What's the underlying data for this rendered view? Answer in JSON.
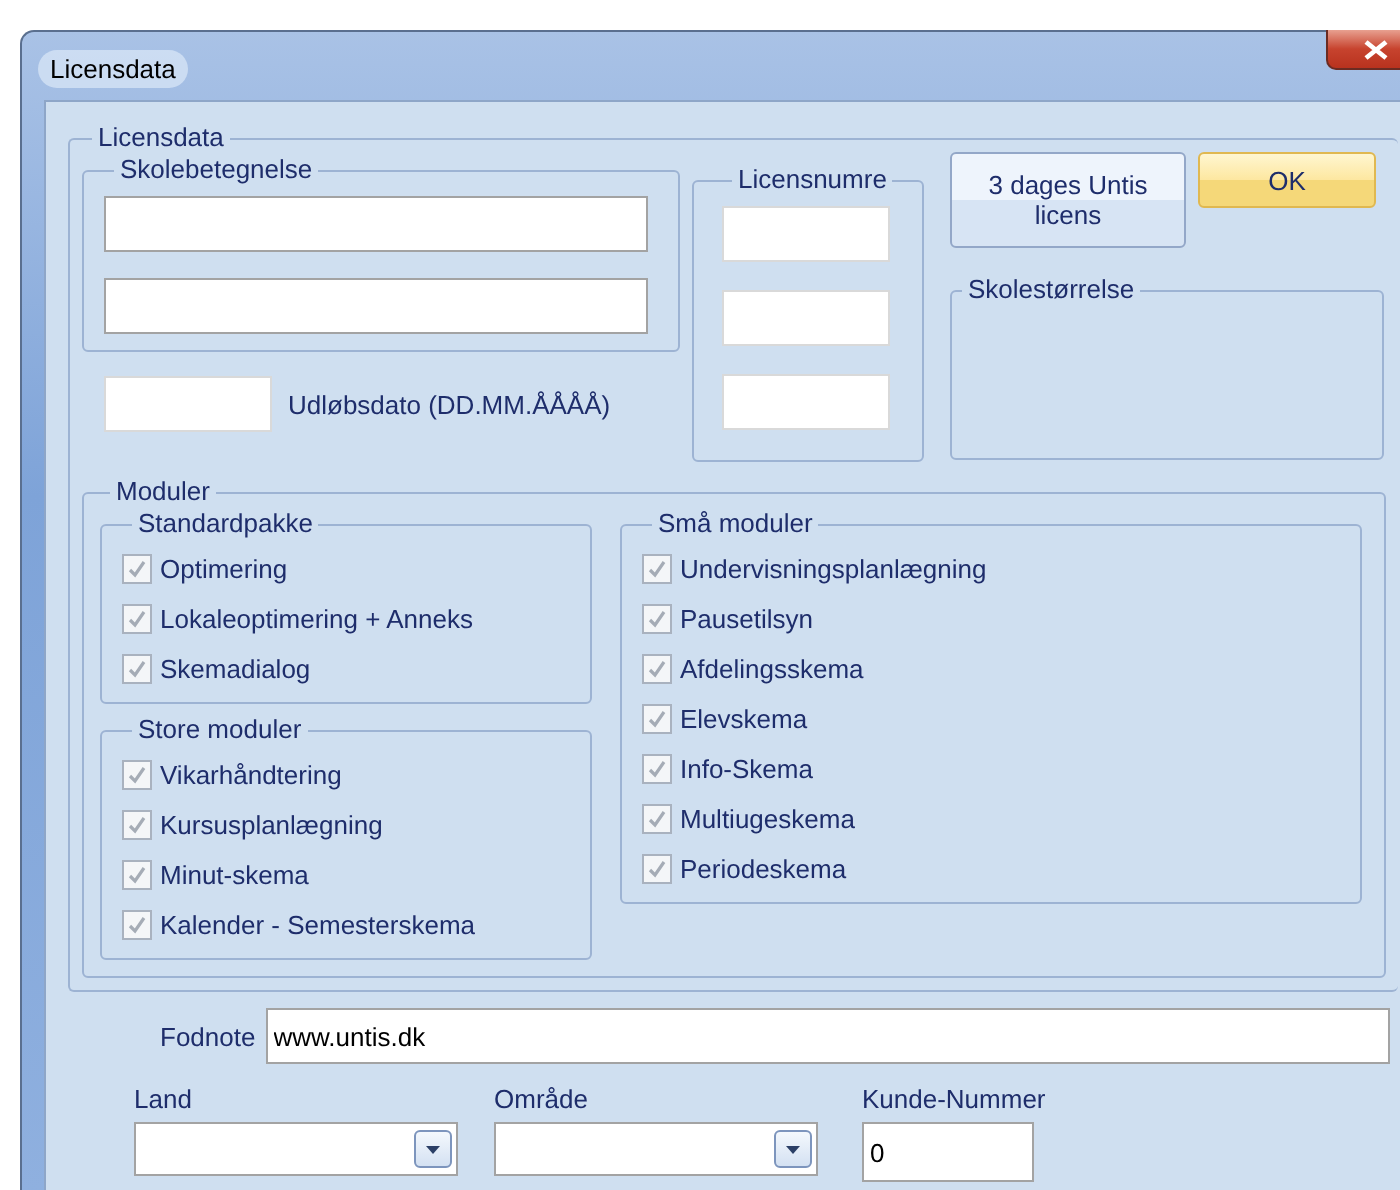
{
  "window": {
    "title": "Licensdata"
  },
  "license": {
    "title": "Licensdata",
    "school_name": {
      "title": "Skolebetegnelse"
    },
    "expiry": {
      "label": "Udløbsdato (DD.MM.ÅÅÅÅ)"
    },
    "license_numbers": {
      "title": "Licensnumre"
    },
    "buttons": [
      {
        "label": "3 dages Untis licens",
        "default": false
      },
      {
        "label": "OK",
        "default": true
      }
    ],
    "school_size": {
      "title": "Skolestørrelse"
    },
    "modules": {
      "title": "Moduler",
      "groups": [
        {
          "title": "Standardpakke",
          "items": [
            {
              "label": "Optimering",
              "checked": true,
              "disabled": true
            },
            {
              "label": "Lokaleoptimering + Anneks",
              "checked": true,
              "disabled": true
            },
            {
              "label": "Skemadialog",
              "checked": true,
              "disabled": true
            }
          ]
        },
        {
          "title": "Store moduler",
          "items": [
            {
              "label": "Vikarhåndtering",
              "checked": true,
              "disabled": true
            },
            {
              "label": "Kursusplanlægning",
              "checked": true,
              "disabled": true
            },
            {
              "label": "Minut-skema",
              "checked": true,
              "disabled": true
            },
            {
              "label": "Kalender - Semesterskema",
              "checked": true,
              "disabled": true
            }
          ]
        },
        {
          "title": "Små moduler",
          "items": [
            {
              "label": "Undervisningsplanlægning",
              "checked": true,
              "disabled": true
            },
            {
              "label": "Pausetilsyn",
              "checked": true,
              "disabled": true
            },
            {
              "label": "Afdelingsskema",
              "checked": true,
              "disabled": true
            },
            {
              "label": "Elevskema",
              "checked": true,
              "disabled": true
            },
            {
              "label": "Info-Skema",
              "checked": true,
              "disabled": true
            },
            {
              "label": "Multiugeskema",
              "checked": true,
              "disabled": true
            },
            {
              "label": "Periodeskema",
              "checked": true,
              "disabled": true
            }
          ]
        }
      ]
    }
  },
  "footer": {
    "footnote": {
      "label": "Fodnote",
      "value": "www.untis.dk"
    },
    "country": {
      "label": "Land"
    },
    "region": {
      "label": "Område"
    },
    "customer_number": {
      "label": "Kunde-Nummer",
      "value": "0"
    }
  }
}
